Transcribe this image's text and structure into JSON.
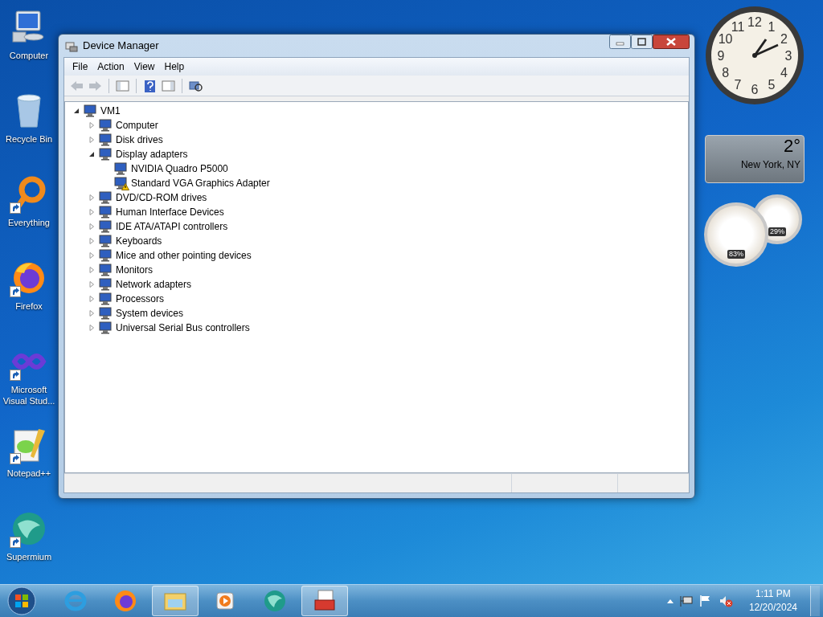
{
  "desktop_icons": [
    {
      "label": "Computer",
      "kind": "computer",
      "shortcut": false
    },
    {
      "label": "Recycle Bin",
      "kind": "bin",
      "shortcut": false
    },
    {
      "label": "Everything",
      "kind": "ring",
      "shortcut": true
    },
    {
      "label": "Firefox",
      "kind": "firefox",
      "shortcut": true
    },
    {
      "label": "Microsoft Visual Stud...",
      "kind": "infinity",
      "shortcut": true
    },
    {
      "label": "Notepad++",
      "kind": "notepad",
      "shortcut": true
    },
    {
      "label": "Supermium",
      "kind": "globe",
      "shortcut": true
    }
  ],
  "gadgets": {
    "clock": {
      "numbers": [
        "12",
        "11",
        "1",
        "10",
        "2",
        "9",
        "3",
        "8",
        "4",
        "7",
        "5",
        "6"
      ]
    },
    "weather": {
      "temperature": "2°",
      "location": "New York, NY"
    },
    "meter": {
      "cpu_reading": "83%",
      "memory_reading": "29%"
    }
  },
  "window": {
    "title": "Device Manager",
    "menu": [
      "File",
      "Action",
      "View",
      "Help"
    ],
    "tree": {
      "label": "VM1",
      "expanded": true,
      "children": [
        {
          "label": "Computer",
          "expanded": false
        },
        {
          "label": "Disk drives",
          "expanded": false
        },
        {
          "label": "Display adapters",
          "expanded": true,
          "children": [
            {
              "label": "NVIDIA Quadro P5000",
              "warning": false
            },
            {
              "label": "Standard VGA Graphics Adapter",
              "warning": true
            }
          ]
        },
        {
          "label": "DVD/CD-ROM drives",
          "expanded": false
        },
        {
          "label": "Human Interface Devices",
          "expanded": false
        },
        {
          "label": "IDE ATA/ATAPI controllers",
          "expanded": false
        },
        {
          "label": "Keyboards",
          "expanded": false
        },
        {
          "label": "Mice and other pointing devices",
          "expanded": false
        },
        {
          "label": "Monitors",
          "expanded": false
        },
        {
          "label": "Network adapters",
          "expanded": false
        },
        {
          "label": "Processors",
          "expanded": false
        },
        {
          "label": "System devices",
          "expanded": false
        },
        {
          "label": "Universal Serial Bus controllers",
          "expanded": false
        }
      ]
    }
  },
  "taskbar": {
    "apps": [
      {
        "kind": "ie",
        "running": false
      },
      {
        "kind": "firefox",
        "running": false
      },
      {
        "kind": "explorer",
        "running": true
      },
      {
        "kind": "media",
        "running": false
      },
      {
        "kind": "globe",
        "running": false
      },
      {
        "kind": "toolbox",
        "running": true
      }
    ],
    "time": "1:11 PM",
    "date": "12/20/2024"
  }
}
